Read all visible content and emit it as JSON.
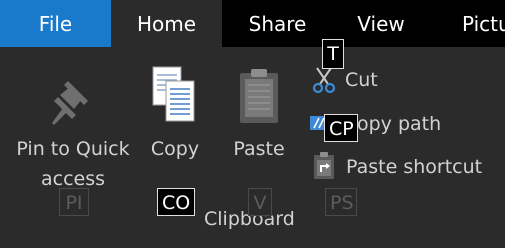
{
  "tabs": {
    "file": "File",
    "home": "Home",
    "share": "Share",
    "view": "View",
    "pictures": "Pictu"
  },
  "clipboard": {
    "pin_line1": "Pin to Quick",
    "pin_line2": "access",
    "copy": "Copy",
    "paste": "Paste",
    "cut": "Cut",
    "copy_path": "opy path",
    "paste_shortcut": "Paste shortcut",
    "group_label": "Clipboard"
  },
  "keytips": {
    "pin": "PI",
    "copy": "CO",
    "paste": "V",
    "paste_shortcut": "PS",
    "cut": "T",
    "copy_path": "CP"
  },
  "icons": {
    "pin": "pushpin-icon",
    "copy": "copy-pages-icon",
    "paste": "clipboard-icon",
    "cut": "scissors-icon",
    "copy_path": "copy-path-icon",
    "paste_shortcut": "paste-shortcut-icon"
  },
  "colors": {
    "file_tab": "#1979ca",
    "tab_strip": "#000000",
    "ribbon_bg": "#2b2b2b",
    "text": "#d2d2d2"
  }
}
